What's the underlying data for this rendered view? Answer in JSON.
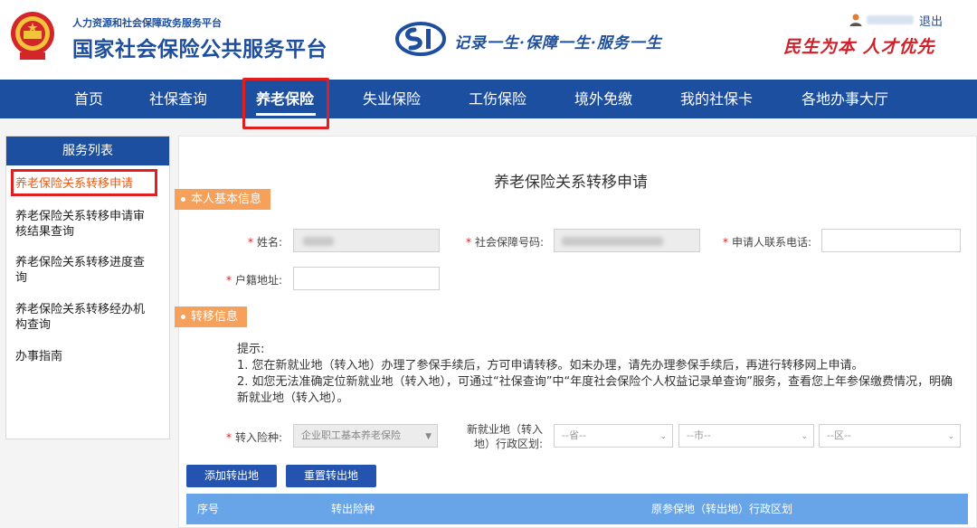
{
  "header": {
    "org_small": "人力资源和社会保障政务服务平台",
    "org_big": "国家社会保险公共服务平台",
    "slogan": "记录一生·保障一生·服务一生",
    "slogan2": "民生为本 人才优先",
    "logout": "退出"
  },
  "nav": {
    "items": [
      "首页",
      "社保查询",
      "养老保险",
      "失业保险",
      "工伤保险",
      "境外免缴",
      "我的社保卡",
      "各地办事大厅"
    ],
    "active": "养老保险"
  },
  "sidebar": {
    "title": "服务列表",
    "items": [
      "养老保险关系转移申请",
      "养老保险关系转移申请审核结果查询",
      "养老保险关系转移进度查询",
      "养老保险关系转移经办机构查询",
      "办事指南"
    ]
  },
  "form": {
    "title": "养老保险关系转移申请",
    "section1": "本人基本信息",
    "name_label": "姓名:",
    "ssn_label": "社会保障号码:",
    "phone_label": "申请人联系电话:",
    "address_label": "户籍地址:",
    "section2": "转移信息",
    "tips_title": "提示:",
    "tip1": "1. 您在新就业地（转入地）办理了参保手续后，方可申请转移。如未办理，请先办理参保手续后，再进行转移网上申请。",
    "tip2": "2. 如您无法准确定位新就业地（转入地），可通过“社保查询”中“年度社会保险个人权益记录单查询”服务，查看您上年参保缴费情况，明确新就业地（转入地）。",
    "insurance_label": "转入险种:",
    "insurance_value": "企业职工基本养老保险",
    "region_label_line1": "新就业地（转入",
    "region_label_line2": "地）行政区划:",
    "province_placeholder": "--省--",
    "city_placeholder": "--市--",
    "district_placeholder": "--区--",
    "add_button": "添加转出地",
    "reset_button": "重置转出地",
    "table_headers": [
      "序号",
      "转出险种",
      "原参保地（转出地）行政区划"
    ]
  },
  "colors": {
    "brand_blue": "#1c4f9f",
    "accent_orange": "#f5a05b",
    "highlight_red": "#e02020",
    "table_header_blue": "#68a4e8"
  },
  "icons": {
    "emblem": "national-emblem-icon",
    "logo": "social-insurance-logo-icon",
    "user": "user-icon"
  }
}
